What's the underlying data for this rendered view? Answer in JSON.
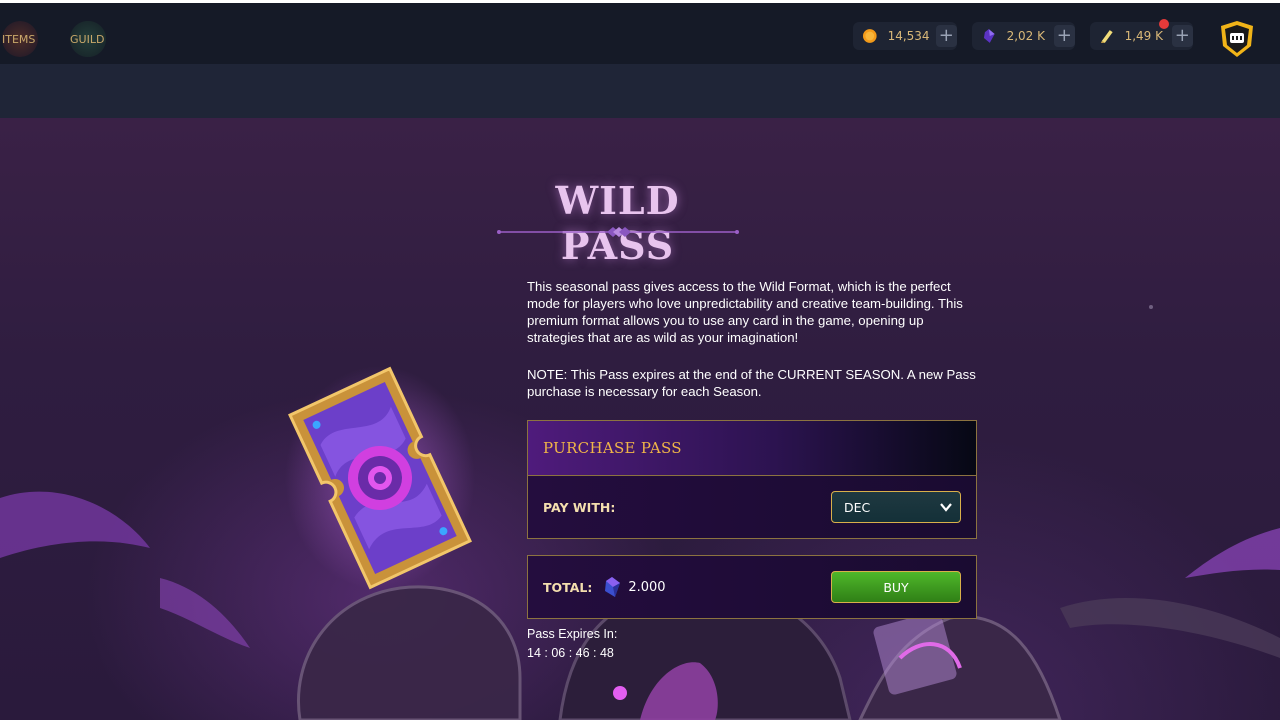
{
  "nav": {
    "items_label": "ITEMS",
    "guild_label": "GUILD"
  },
  "currencies": [
    {
      "name": "gold-coin",
      "value": "14,534",
      "color": "#f29a1a"
    },
    {
      "name": "dec-crystal",
      "value": "2,02 K",
      "color": "#6a3bd1"
    },
    {
      "name": "scroll",
      "value": "1,49 K",
      "color": "#f2dd7a"
    }
  ],
  "hero": {
    "title": "WILD PASS",
    "description": "This seasonal pass gives access to the Wild Format, which is the perfect mode for players who love unpredictability and creative team-building. This premium format allows you to use any card in the game, opening up strategies that are as wild as your imagination!",
    "note": "NOTE: This Pass expires at the end of the CURRENT SEASON. A new Pass purchase is necessary for each Season."
  },
  "purchase": {
    "header": "PURCHASE PASS",
    "pay_with_label": "PAY WITH:",
    "pay_with_value": "DEC",
    "total_label": "TOTAL:",
    "total_value": "2.000",
    "buy_label": "BUY"
  },
  "expiry": {
    "label": "Pass Expires In:",
    "countdown": "14 : 06 : 46 : 48"
  },
  "colors": {
    "accent_gold": "#f0b548",
    "buy_green": "#3f9d21",
    "title_lilac": "#e8c4ee",
    "notification": "#e53a3a"
  }
}
